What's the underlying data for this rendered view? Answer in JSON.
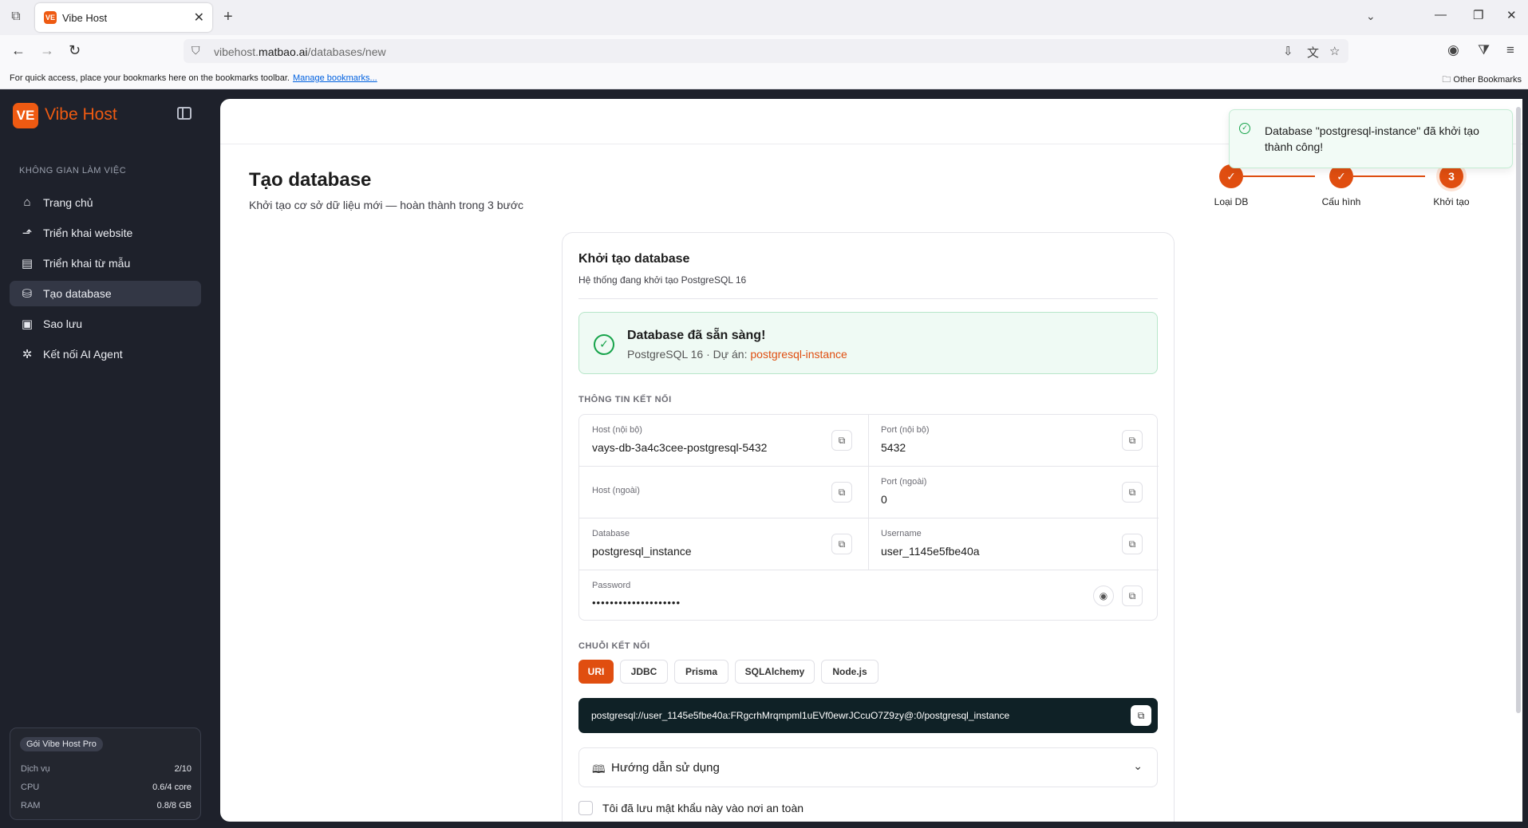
{
  "browser": {
    "tab_title": "Vibe Host",
    "url_prefix": "vibehost.",
    "url_domain": "matbao.ai",
    "url_path": "/databases/new",
    "bookmarks_hint": "For quick access, place your bookmarks here on the bookmarks toolbar.",
    "manage_bookmarks": "Manage bookmarks...",
    "other_bookmarks": "Other Bookmarks"
  },
  "sidebar": {
    "logo_text": "VE",
    "brand": "Vibe Host",
    "section_label": "KHÔNG GIAN LÀM VIỆC",
    "items": [
      {
        "label": "Trang chủ",
        "icon": "home-icon"
      },
      {
        "label": "Triển khai website",
        "icon": "rocket-icon"
      },
      {
        "label": "Triển khai từ mẫu",
        "icon": "package-icon"
      },
      {
        "label": "Tạo database",
        "icon": "database-icon",
        "active": true
      },
      {
        "label": "Sao lưu",
        "icon": "hard-drive-icon"
      },
      {
        "label": "Kết nối AI Agent",
        "icon": "sparkle-icon"
      }
    ],
    "plan": {
      "name": "Gói Vibe Host Pro",
      "rows": [
        {
          "label": "Dịch vụ",
          "value": "2/10"
        },
        {
          "label": "CPU",
          "value": "0.6/4 core"
        },
        {
          "label": "RAM",
          "value": "0.8/8 GB"
        }
      ]
    }
  },
  "toast": {
    "message": "Database \"postgresql-instance\" đã khởi tạo thành công!"
  },
  "page": {
    "title": "Tạo database",
    "subtitle": "Khởi tạo cơ sở dữ liệu mới — hoàn thành trong 3 bước"
  },
  "stepper": {
    "steps": [
      {
        "label": "Loại DB",
        "state": "done"
      },
      {
        "label": "Cấu hình",
        "state": "done"
      },
      {
        "label": "Khởi tạo",
        "state": "current",
        "number": "3"
      }
    ]
  },
  "card": {
    "title": "Khởi tạo database",
    "subtitle": "Hệ thống đang khởi tạo PostgreSQL 16",
    "ready_title": "Database đã sẵn sàng!",
    "ready_sub": "PostgreSQL 16 · Dự án: ",
    "ready_project": "postgresql-instance",
    "conn_info_label": "THÔNG TIN KẾT NỐI",
    "fields": {
      "host_internal": {
        "label": "Host (nội bộ)",
        "value": "vays-db-3a4c3cee-postgresql-5432"
      },
      "port_internal": {
        "label": "Port (nội bộ)",
        "value": "5432"
      },
      "host_external": {
        "label": "Host (ngoài)",
        "value": ""
      },
      "port_external": {
        "label": "Port (ngoài)",
        "value": "0"
      },
      "database": {
        "label": "Database",
        "value": "postgresql_instance"
      },
      "username": {
        "label": "Username",
        "value": "user_1145e5fbe40a"
      },
      "password": {
        "label": "Password",
        "value": "••••••••••••••••••••"
      }
    },
    "conn_string_label": "CHUỖI KẾT NỐI",
    "tabs": [
      "URI",
      "JDBC",
      "Prisma",
      "SQLAlchemy",
      "Node.js"
    ],
    "active_tab": "URI",
    "connection_string": "postgresql://user_1145e5fbe40a:FRgcrhMrqmpml1uEVf0ewrJCcuO7Z9zy@:0/postgresql_instance",
    "guide_label": "Hướng dẫn sử dụng",
    "confirm_label": "Tôi đã lưu mật khẩu này vào nơi an toàn"
  },
  "colors": {
    "accent": "#e04e10",
    "sidebar_bg": "#1e212b",
    "success": "#16a34a",
    "code_bg": "#0f2126"
  }
}
